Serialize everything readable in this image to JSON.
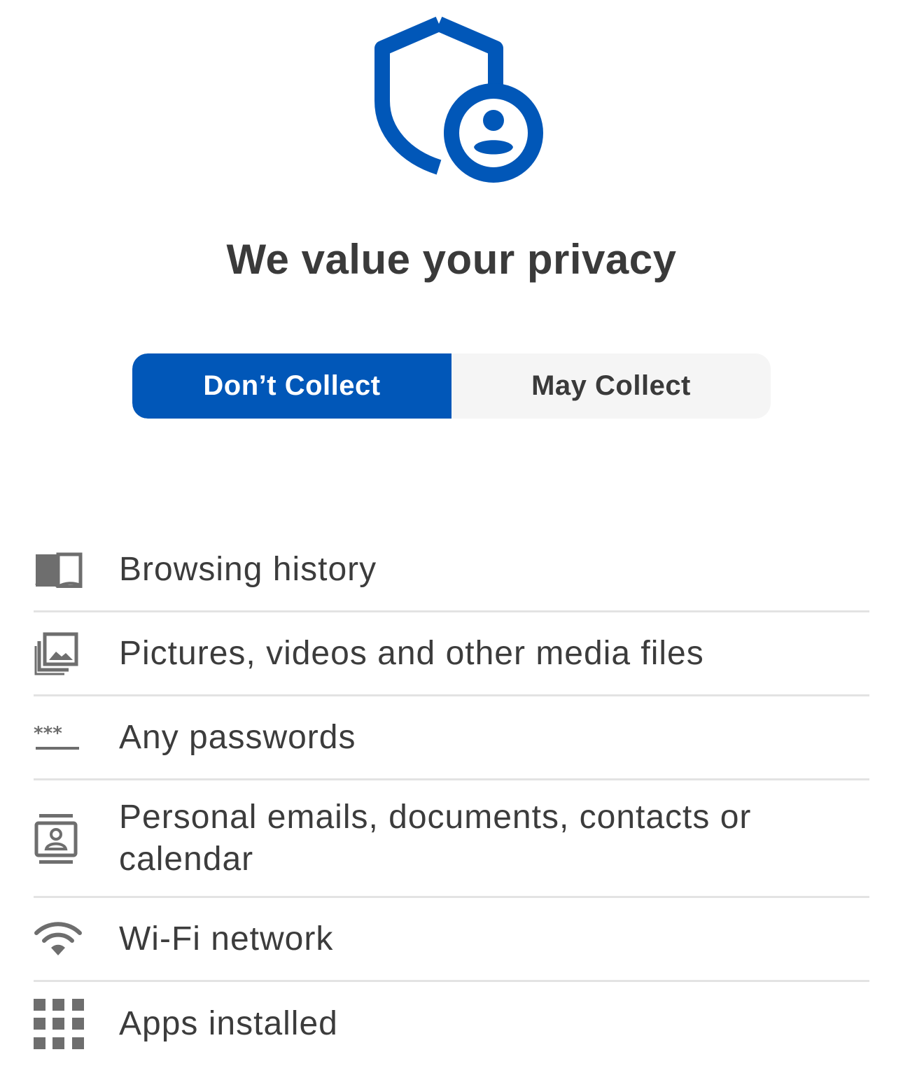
{
  "header": {
    "title": "We value your privacy",
    "icon": "shield-person-icon"
  },
  "toggle": {
    "dont_collect": "Don’t Collect",
    "may_collect": "May Collect",
    "selected": "dont_collect"
  },
  "items": [
    {
      "label": "Browsing history",
      "icon": "book-icon"
    },
    {
      "label": "Pictures, videos and other media files",
      "icon": "photo-library-icon"
    },
    {
      "label": "Any passwords",
      "icon": "password-icon"
    },
    {
      "label": "Personal emails, documents, contacts or calendar",
      "icon": "contact-card-icon"
    },
    {
      "label": "Wi-Fi network",
      "icon": "wifi-icon"
    },
    {
      "label": "Apps installed",
      "icon": "apps-grid-icon"
    }
  ],
  "colors": {
    "accent": "#0157b8",
    "icon_gray": "#6e6e6e",
    "text": "#3a3a3a",
    "divider": "#e3e3e3"
  }
}
